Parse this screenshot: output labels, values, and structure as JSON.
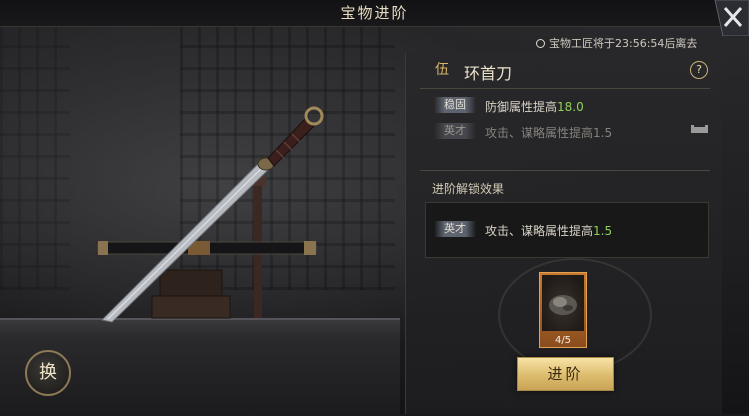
{
  "header": {
    "title": "宝物进阶"
  },
  "timer": {
    "text": "宝物工匠将于23:56:54后离去"
  },
  "treasure": {
    "icon_char": "伍",
    "name": "环首刀",
    "help": "?"
  },
  "attributes": [
    {
      "tag": "稳固",
      "prefix": "防御属性提高",
      "value": "18.0",
      "active": true
    },
    {
      "tag": "英才",
      "prefix": "攻击、谋略属性提高",
      "value": "1.5",
      "active": false
    }
  ],
  "unlock": {
    "section_title": "进阶解锁效果",
    "tag": "英才",
    "prefix": "攻击、谋略属性提高",
    "value": "1.5"
  },
  "material": {
    "count": "4/5"
  },
  "buttons": {
    "advance": "进阶",
    "swap": "换"
  },
  "colors": {
    "accent_gold": "#dcbc6d",
    "value_green": "#8fd05a"
  }
}
